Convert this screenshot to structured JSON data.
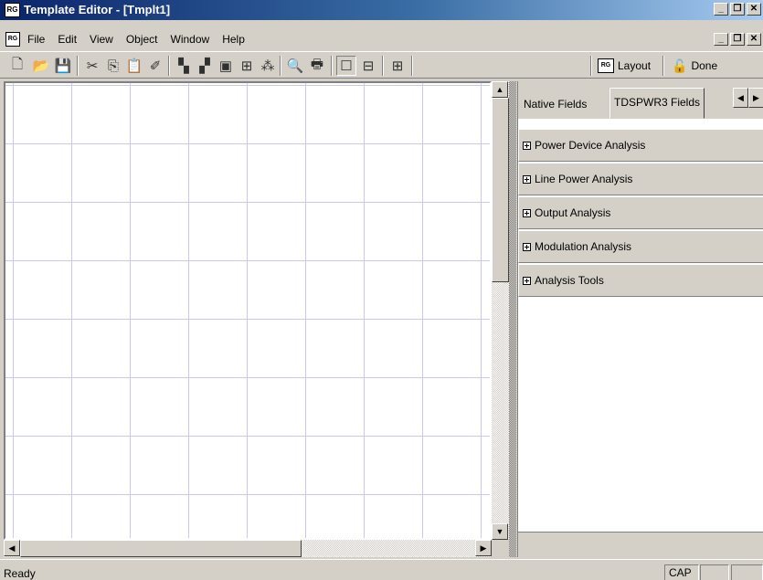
{
  "window": {
    "title": "Template Editor - [Tmplt1]",
    "app_icon_text": "RG"
  },
  "menu": {
    "items": [
      "File",
      "Edit",
      "View",
      "Object",
      "Window",
      "Help"
    ]
  },
  "toolbar": {
    "buttons": [
      "new-icon",
      "open-icon",
      "save-icon",
      "cut-icon",
      "copy-icon",
      "paste-icon",
      "erase-icon",
      "bring-forward-icon",
      "send-backward-icon",
      "group-icon",
      "align-icon",
      "distribute-icon",
      "print-preview-icon",
      "print-icon",
      "layout-single-icon",
      "layout-split-icon",
      "layout-grid-icon"
    ],
    "layout_label": "Layout",
    "done_label": "Done"
  },
  "panel": {
    "tabs": [
      "Native Fields",
      "TDSPWR3 Fields"
    ],
    "groups": [
      "Power Device Analysis",
      "Line Power Analysis",
      "Output Analysis",
      "Modulation Analysis",
      "Analysis Tools"
    ]
  },
  "status": {
    "text": "Ready",
    "caps": "CAP"
  }
}
